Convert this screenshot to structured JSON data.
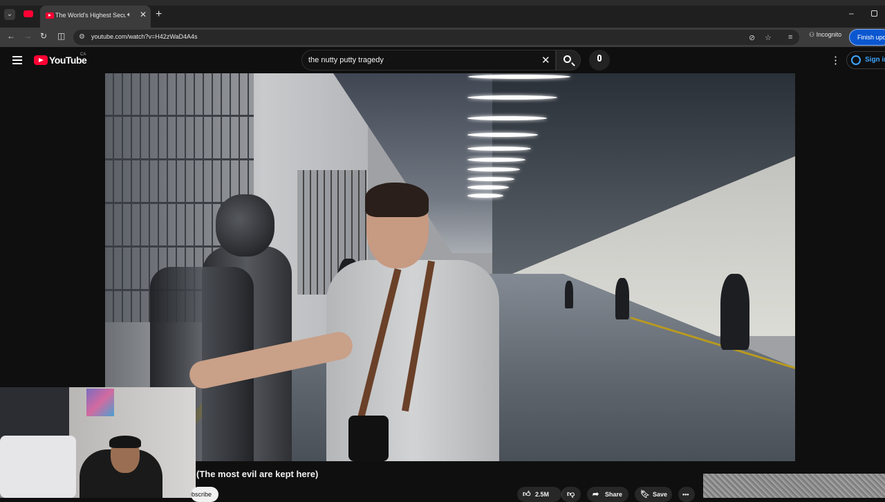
{
  "browser": {
    "tab_title": "The World's Highest Securit",
    "url": "youtube.com/watch?v=H42zWaD4A4s",
    "incognito_label": "Incognito",
    "finish_update_label": "Finish upda"
  },
  "youtube": {
    "logo_text": "YouTube",
    "country_code": "CA",
    "search_query": "the nutty putty tragedy",
    "sign_in_label": "Sign in"
  },
  "video": {
    "title_visible": "(The most evil are kept here)",
    "subscribe_label": "Subscribe",
    "likes": "2.5M",
    "share_label": "Share",
    "save_label": "Save",
    "more_label": "•••"
  },
  "colors": {
    "youtube_red": "#ff0033",
    "link_blue": "#3ea6ff",
    "update_blue": "#0b57d0"
  }
}
